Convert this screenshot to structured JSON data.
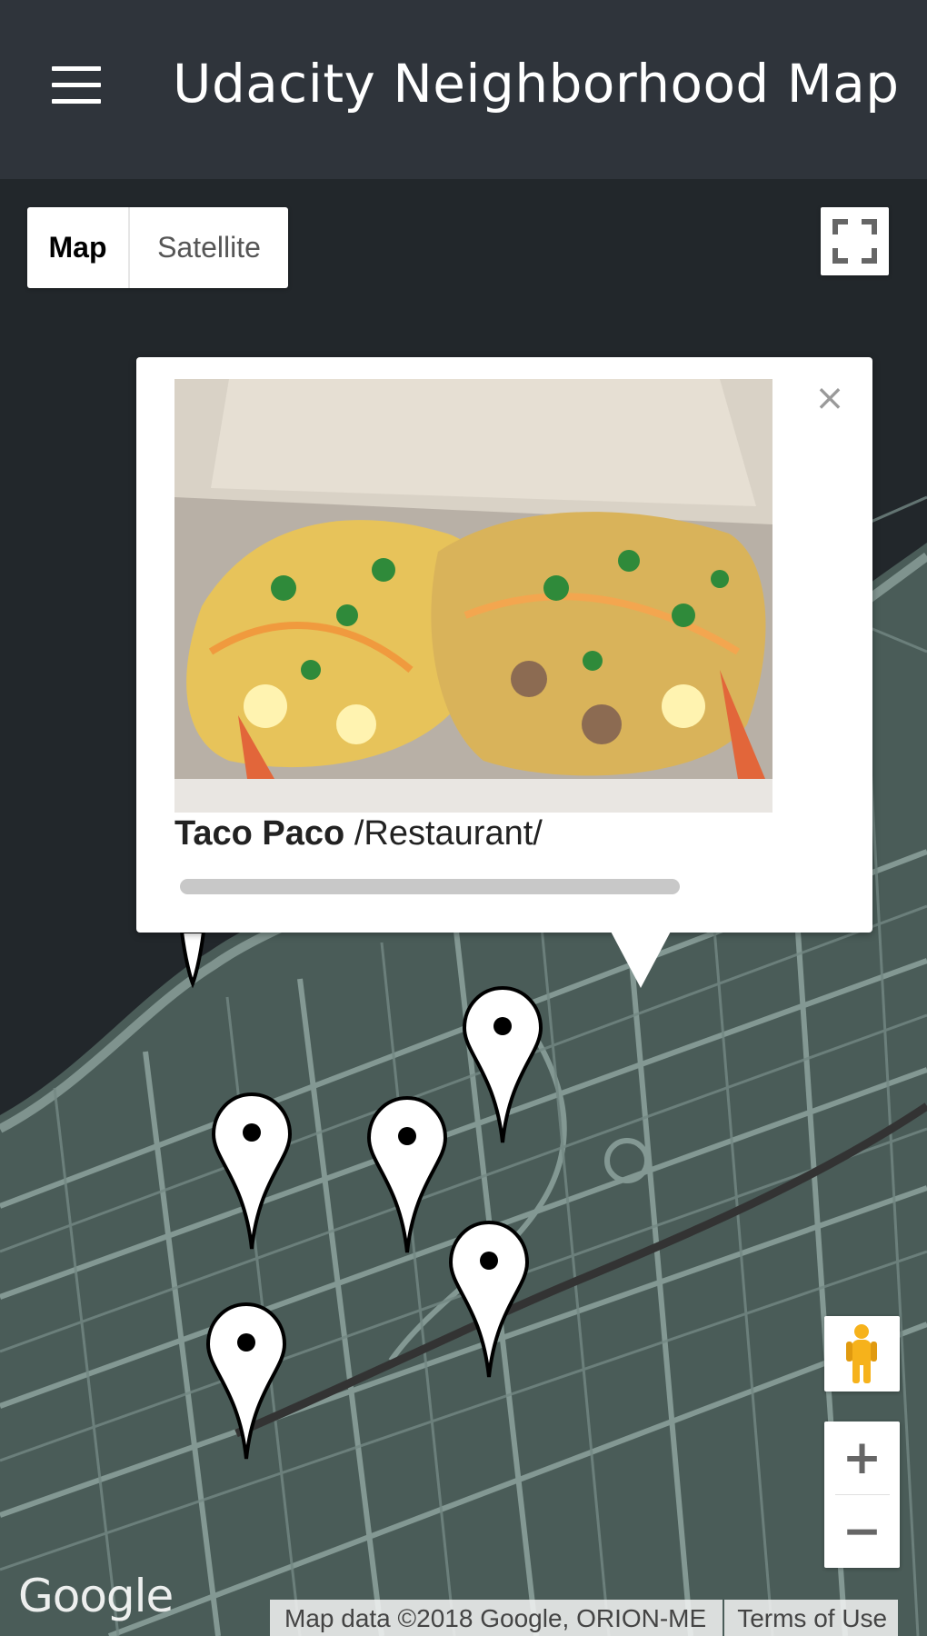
{
  "header": {
    "title": "Udacity Neighborhood Map",
    "menu_icon": "hamburger-menu-icon"
  },
  "map_controls": {
    "map_type_options": [
      "Map",
      "Satellite"
    ],
    "selected_map_type": "Map",
    "fullscreen_icon": "fullscreen-icon",
    "pegman_icon": "street-view-pegman-icon",
    "zoom_in_label": "+",
    "zoom_out_label": "−"
  },
  "info_window": {
    "place_name": "Taco Paco",
    "place_type": "/Restaurant/",
    "close_label": "×",
    "photo_description_icon": "food-photo"
  },
  "markers_count": 6,
  "footer": {
    "logo_text": "Google",
    "map_data": "Map data ©2018 Google, ORION-ME",
    "terms": "Terms of Use"
  },
  "colors": {
    "header_bg": "#2f343b",
    "map_water": "#22272b",
    "map_land": "#4a5c58",
    "map_roads": "#8a9f9a"
  }
}
